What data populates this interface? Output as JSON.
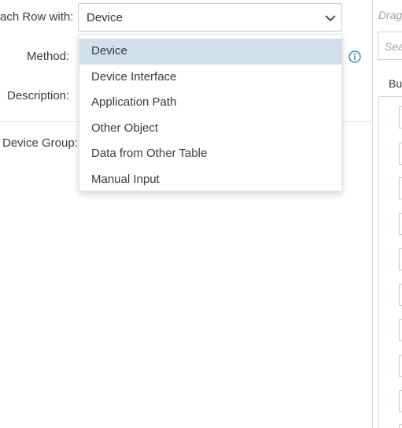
{
  "form": {
    "each_row_label": "ach Row with:",
    "method_label": "Method:",
    "description_label": "Description:",
    "device_group_label": "Device Group:",
    "each_row_select": {
      "value": "Device"
    }
  },
  "dropdown": {
    "options": [
      "Device",
      "Device Interface",
      "Application Path",
      "Other Object",
      "Data from Other Table",
      "Manual Input"
    ],
    "selected": "Device"
  },
  "right_panel": {
    "drag_hint": "Drag",
    "search_placeholder": "Sea",
    "section_label": "Bu"
  },
  "colors": {
    "selected_option_bg": "#d0e1ec",
    "info_icon": "#1a7fc4"
  },
  "icons": {
    "select_arrow": "chevron-down-icon",
    "method_info": "info-icon"
  }
}
